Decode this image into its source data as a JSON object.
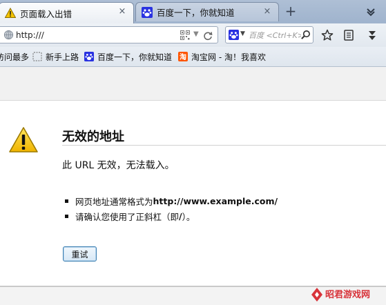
{
  "tabs": [
    {
      "label": "页面载入出错",
      "icon": "warning-icon",
      "active": true,
      "close": "×"
    },
    {
      "label": "百度一下，你就知道",
      "icon": "baidu-paw-icon",
      "active": false,
      "close": "×"
    }
  ],
  "new_tab_label": "+",
  "nav": {
    "url_value": "http:///",
    "search_placeholder": "百度 <Ctrl+K>",
    "reload_glyph": "C"
  },
  "bookmarks": [
    {
      "label": "访问最多",
      "icon": "none"
    },
    {
      "label": "新手上路",
      "icon": "dashed-box-icon"
    },
    {
      "label": "百度一下，你就知道",
      "icon": "baidu-paw-icon"
    },
    {
      "label": "淘宝网 - 淘！我喜欢",
      "icon": "taobao-icon"
    }
  ],
  "error": {
    "title": "无效的地址",
    "short": "此 URL 无效，无法载入。",
    "items": [
      {
        "prefix": "网页地址通常格式为 ",
        "bold": "http://www.example.com/",
        "suffix": ""
      },
      {
        "prefix": "请确认您使用了正斜杠（即 ",
        "bold": "/",
        "suffix": "）。"
      }
    ],
    "retry_label": "重试"
  },
  "watermark": "昭君游戏网",
  "colors": {
    "accent": "#3c7fb1",
    "baidu_blue": "#2932e1",
    "taobao_orange": "#ff5500",
    "warning_yellow": "#f5c400"
  }
}
